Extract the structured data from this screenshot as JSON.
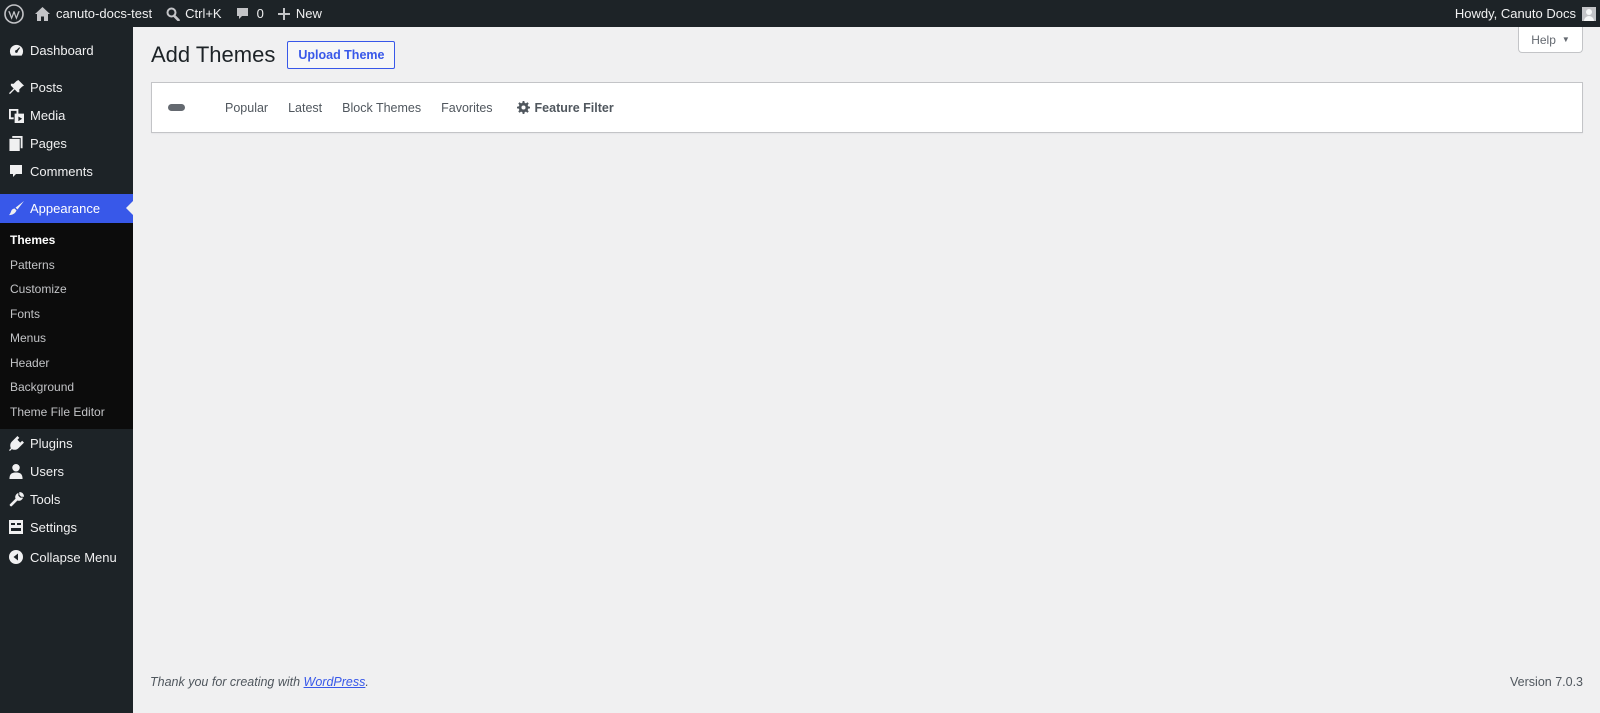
{
  "adminbar": {
    "site_name": "canuto-docs-test",
    "search_shortcut": "Ctrl+K",
    "comments_count": "0",
    "new_label": "New",
    "greeting": "Howdy, Canuto Docs"
  },
  "sidebar": {
    "items": [
      {
        "label": "Dashboard",
        "icon": "dashboard-icon"
      },
      {
        "label": "Posts",
        "icon": "pin-icon"
      },
      {
        "label": "Media",
        "icon": "media-icon"
      },
      {
        "label": "Pages",
        "icon": "pages-icon"
      },
      {
        "label": "Comments",
        "icon": "comment-icon"
      },
      {
        "label": "Appearance",
        "icon": "brush-icon"
      },
      {
        "label": "Plugins",
        "icon": "plug-icon"
      },
      {
        "label": "Users",
        "icon": "user-icon"
      },
      {
        "label": "Tools",
        "icon": "wrench-icon"
      },
      {
        "label": "Settings",
        "icon": "settings-icon"
      },
      {
        "label": "Collapse Menu",
        "icon": "collapse-icon"
      }
    ],
    "appearance_submenu": [
      "Themes",
      "Patterns",
      "Customize",
      "Fonts",
      "Menus",
      "Header",
      "Background",
      "Theme File Editor"
    ],
    "accent_color": "#3858e9"
  },
  "main": {
    "title": "Add Themes",
    "upload_button": "Upload Theme",
    "help_label": "Help",
    "filters": [
      "Popular",
      "Latest",
      "Block Themes",
      "Favorites"
    ],
    "feature_filter": "Feature Filter"
  },
  "footer": {
    "thanks_prefix": "Thank you for creating with ",
    "thanks_link": "WordPress",
    "thanks_suffix": ".",
    "version": "Version 7.0.3"
  }
}
